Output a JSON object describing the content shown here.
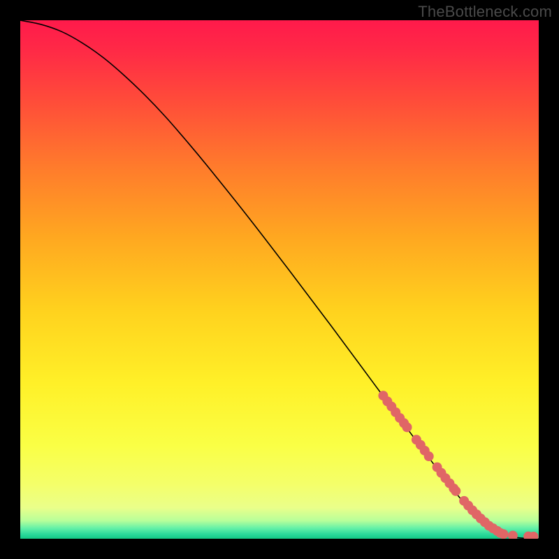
{
  "watermark": "TheBottleneck.com",
  "colors": {
    "bg": "#000000",
    "watermark": "#4a4a4a",
    "curve": "#000000",
    "marker": "#e06666",
    "gradient_stops": [
      {
        "offset": 0.0,
        "color": "#ff1a4b"
      },
      {
        "offset": 0.06,
        "color": "#ff2a46"
      },
      {
        "offset": 0.15,
        "color": "#ff4a3a"
      },
      {
        "offset": 0.28,
        "color": "#ff7a2c"
      },
      {
        "offset": 0.42,
        "color": "#ffa820"
      },
      {
        "offset": 0.56,
        "color": "#ffd21e"
      },
      {
        "offset": 0.7,
        "color": "#fff028"
      },
      {
        "offset": 0.82,
        "color": "#faff45"
      },
      {
        "offset": 0.896,
        "color": "#f4ff6a"
      },
      {
        "offset": 0.94,
        "color": "#eaff8a"
      },
      {
        "offset": 0.965,
        "color": "#b8ff9a"
      },
      {
        "offset": 0.98,
        "color": "#62f0a8"
      },
      {
        "offset": 0.992,
        "color": "#28d89a"
      },
      {
        "offset": 1.0,
        "color": "#14c985"
      }
    ]
  },
  "chart_data": {
    "type": "line",
    "title": "",
    "xlabel": "",
    "ylabel": "",
    "xlim": [
      0,
      100
    ],
    "ylim": [
      0,
      100
    ],
    "series": [
      {
        "name": "curve",
        "x": [
          0,
          4,
          8,
          12,
          16,
          20,
          24,
          28,
          32,
          36,
          44,
          52,
          60,
          68,
          76,
          82,
          86,
          88,
          90,
          92,
          94,
          96,
          98,
          100
        ],
        "y": [
          100,
          99.2,
          97.8,
          95.6,
          92.8,
          89.4,
          85.6,
          81.4,
          76.8,
          72.0,
          62.0,
          51.6,
          41.0,
          30.2,
          19.4,
          11.4,
          6.4,
          4.2,
          2.6,
          1.4,
          0.6,
          0.2,
          0.05,
          0.0
        ]
      },
      {
        "name": "markers",
        "x": [
          70.0,
          70.8,
          71.6,
          72.4,
          73.2,
          74.0,
          74.6,
          76.4,
          77.2,
          78.0,
          78.8,
          80.4,
          81.2,
          82.0,
          82.8,
          83.6,
          84.0,
          85.6,
          86.4,
          87.2,
          88.0,
          88.8,
          89.6,
          90.4,
          91.2,
          92.0,
          92.6,
          93.2,
          95.0,
          98.0,
          99.0
        ],
        "y": [
          27.6,
          26.5,
          25.5,
          24.4,
          23.3,
          22.3,
          21.5,
          19.1,
          18.1,
          17.0,
          15.9,
          13.8,
          12.7,
          11.7,
          10.7,
          9.7,
          9.2,
          7.3,
          6.4,
          5.5,
          4.7,
          3.9,
          3.2,
          2.5,
          2.0,
          1.5,
          1.1,
          0.9,
          0.6,
          0.45,
          0.42
        ]
      }
    ]
  }
}
